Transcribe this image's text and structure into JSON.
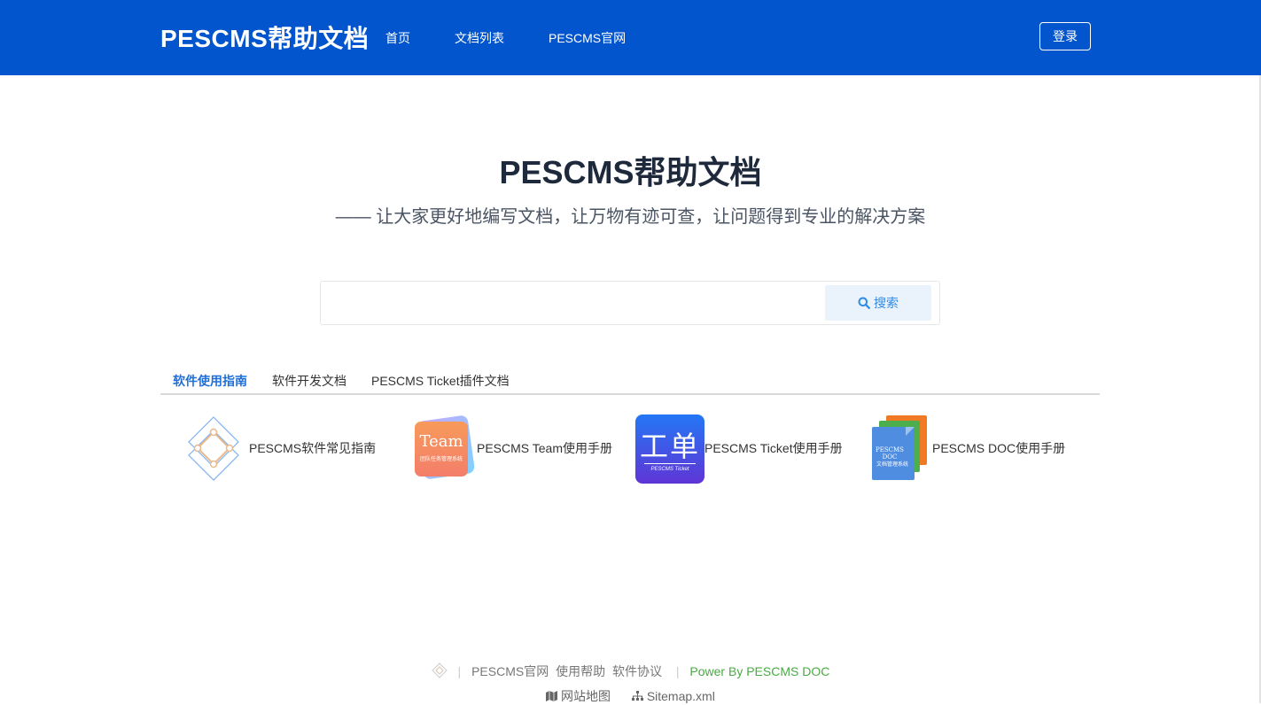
{
  "header": {
    "brand": "PESCMS帮助文档",
    "nav": [
      "首页",
      "文档列表",
      "PESCMS官网"
    ],
    "login": "登录"
  },
  "hero": {
    "title": "PESCMS帮助文档",
    "subtitle": "—— 让大家更好地编写文档，让万物有迹可查，让问题得到专业的解决方案"
  },
  "search": {
    "value": "",
    "placeholder": "",
    "button": "搜索"
  },
  "tabs": [
    {
      "label": "软件使用指南",
      "active": true
    },
    {
      "label": "软件开发文档",
      "active": false
    },
    {
      "label": "PESCMS Ticket插件文档",
      "active": false
    }
  ],
  "cards": [
    {
      "label": "PESCMS软件常见指南",
      "icon": "diamond-logo-icon"
    },
    {
      "label": "PESCMS Team使用手册",
      "icon": "team-app-icon",
      "icon_text": "Team",
      "icon_subtext": "团队任务管理系统"
    },
    {
      "label": "PESCMS Ticket使用手册",
      "icon": "ticket-app-icon",
      "icon_text": "工单",
      "icon_subtext": "PESCMS Ticket"
    },
    {
      "label": "PESCMS DOC使用手册",
      "icon": "doc-files-icon",
      "icon_text": "PESCMS DOC",
      "icon_subtext": "文档管理系统"
    }
  ],
  "footer": {
    "links": [
      "PESCMS官网",
      "使用帮助",
      "软件协议"
    ],
    "power": "Power By PESCMS DOC",
    "sitemap": "网站地图",
    "sitemap_xml": "Sitemap.xml"
  },
  "colors": {
    "header_bg": "#0255cc",
    "accent": "#1e6fd9",
    "power": "#4aaa44"
  }
}
